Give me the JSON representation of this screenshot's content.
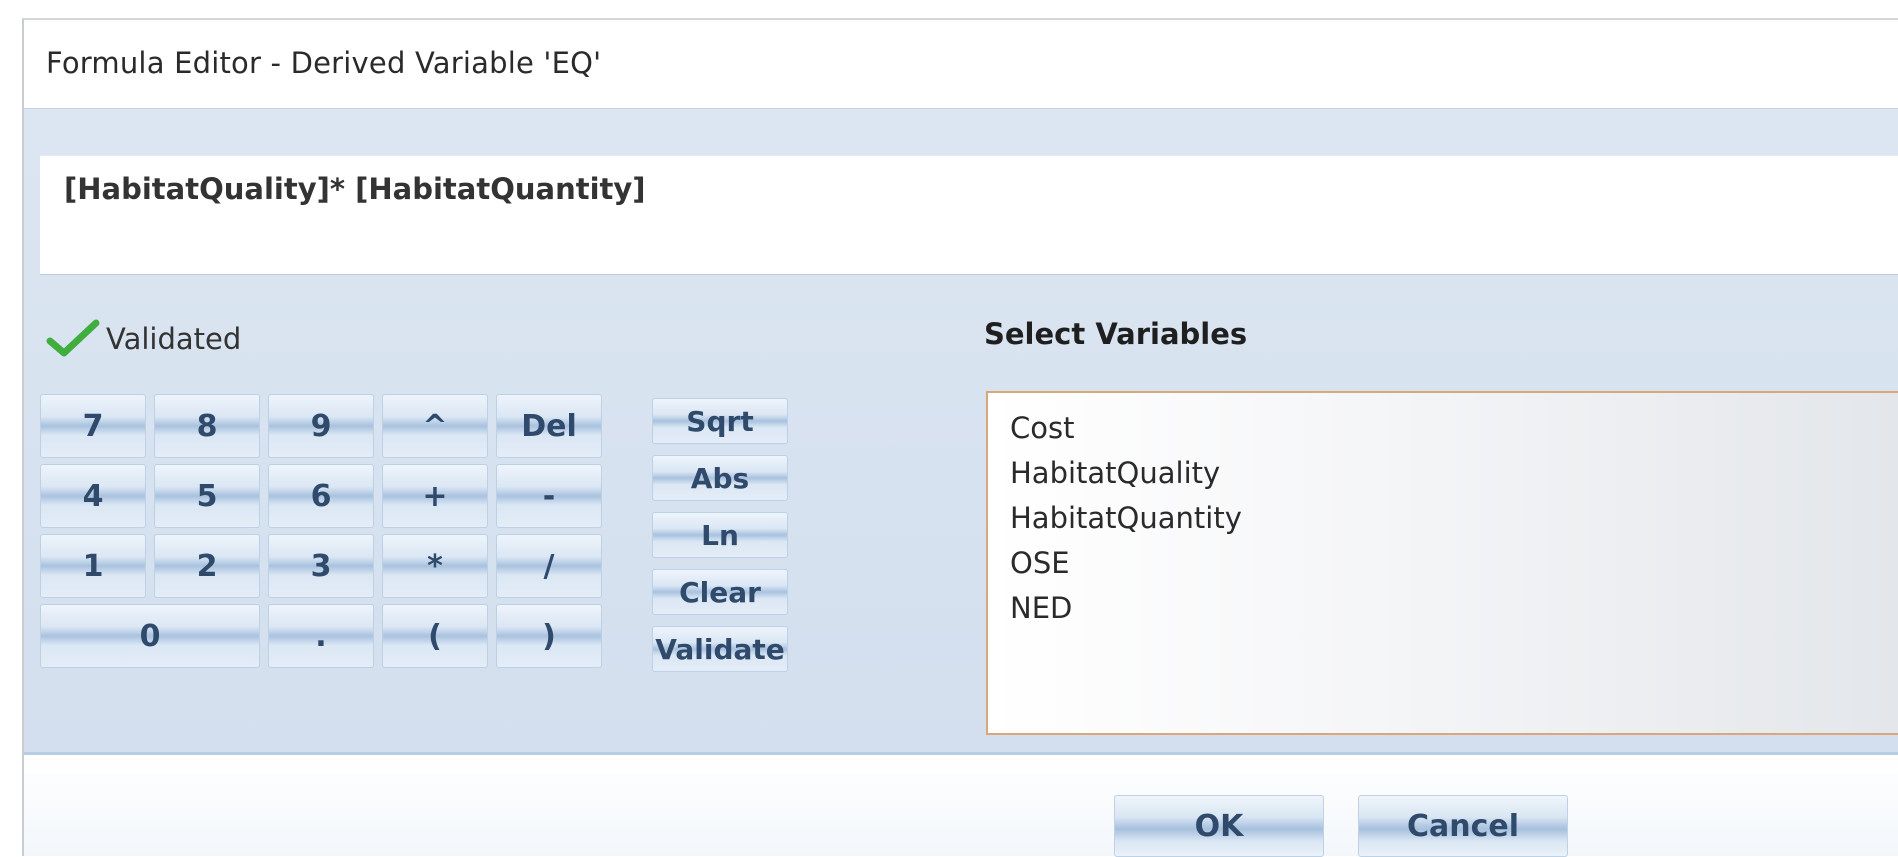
{
  "window": {
    "title": "Formula Editor - Derived Variable 'EQ'"
  },
  "formula": {
    "expression": "[HabitatQuality]* [HabitatQuantity]"
  },
  "status": {
    "label": "Validated",
    "icon": "checkmark-icon",
    "color": "#3fae3f"
  },
  "keypad": {
    "keys": [
      "7",
      "8",
      "9",
      "^",
      "Del",
      "4",
      "5",
      "6",
      "+",
      "-",
      "1",
      "2",
      "3",
      "*",
      "/",
      "0",
      ".",
      "(",
      ")"
    ]
  },
  "functions": [
    "Sqrt",
    "Abs",
    "Ln",
    "Clear",
    "Validate"
  ],
  "variables": {
    "heading": "Select Variables",
    "items": [
      "Cost",
      "HabitatQuality",
      "HabitatQuantity",
      "OSE",
      "NED"
    ]
  },
  "actions": {
    "ok": "OK",
    "cancel": "Cancel"
  },
  "colors": {
    "accent": "#a9c2df",
    "list_border": "#d9a77a",
    "button_text": "#2f4a6b"
  }
}
